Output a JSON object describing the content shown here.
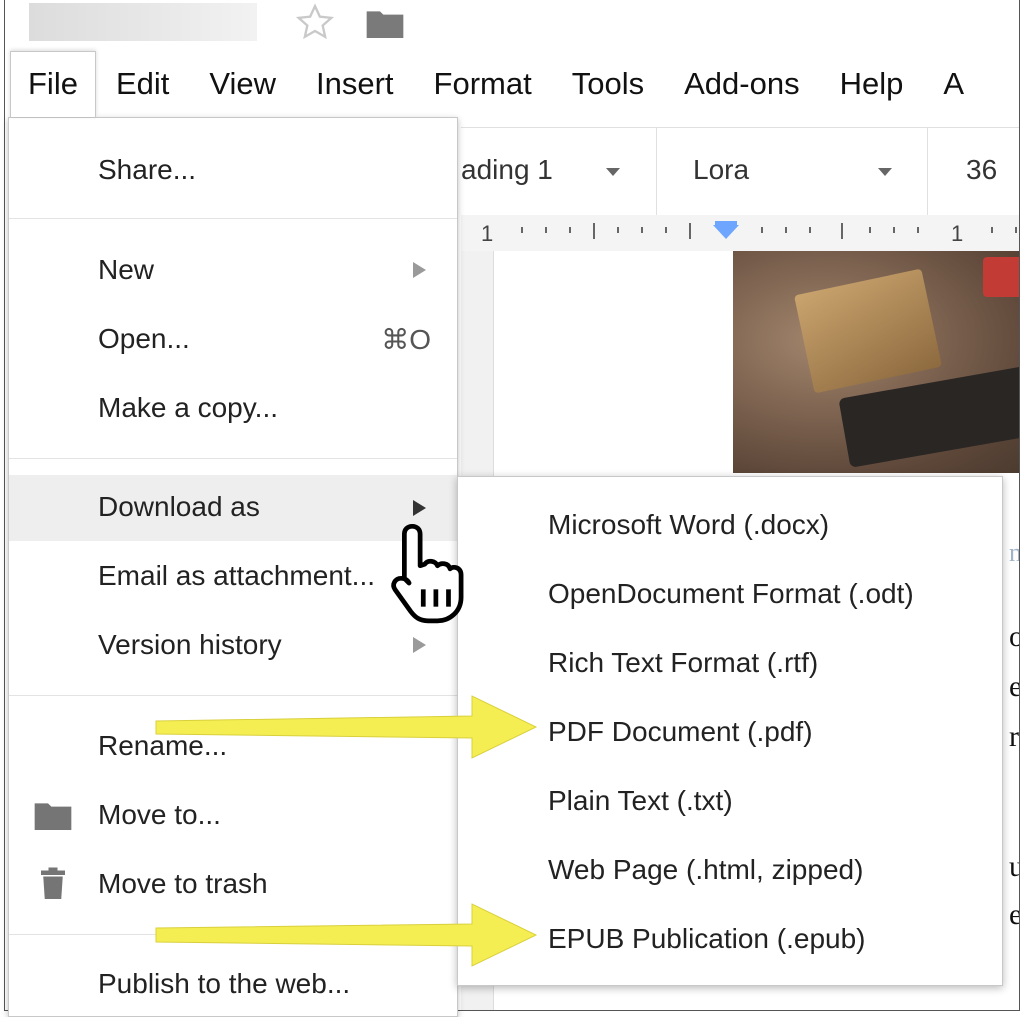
{
  "header": {
    "star_icon": "star-outline-icon",
    "folder_icon": "folder-icon"
  },
  "menubar": {
    "items": [
      {
        "label": "File"
      },
      {
        "label": "Edit"
      },
      {
        "label": "View"
      },
      {
        "label": "Insert"
      },
      {
        "label": "Format"
      },
      {
        "label": "Tools"
      },
      {
        "label": "Add-ons"
      },
      {
        "label": "Help"
      },
      {
        "label": "A"
      }
    ]
  },
  "toolbar": {
    "style": "ading 1",
    "font": "Lora",
    "size": "36"
  },
  "ruler": {
    "left_num": "1",
    "right_num": "1"
  },
  "file_menu": {
    "share": "Share...",
    "new": "New",
    "open": "Open...",
    "open_shortcut": "⌘O",
    "copy": "Make a copy...",
    "download": "Download as",
    "email": "Email as attachment...",
    "version": "Version history",
    "rename": "Rename...",
    "move": "Move to...",
    "trash": "Move to trash",
    "publish": "Publish to the web..."
  },
  "download_menu": {
    "items": [
      {
        "label": "Microsoft Word (.docx)"
      },
      {
        "label": "OpenDocument Format (.odt)"
      },
      {
        "label": "Rich Text Format (.rtf)"
      },
      {
        "label": "PDF Document (.pdf)"
      },
      {
        "label": "Plain Text (.txt)"
      },
      {
        "label": "Web Page (.html, zipped)"
      },
      {
        "label": "EPUB Publication (.epub)"
      }
    ]
  },
  "doc_fragments": [
    "n",
    "o",
    "e",
    "r",
    "u",
    "e"
  ],
  "colors": {
    "annotation_arrow": "#f4ee53",
    "ruler_marker": "#6ea6ff",
    "highlight": "#eeeeee"
  }
}
